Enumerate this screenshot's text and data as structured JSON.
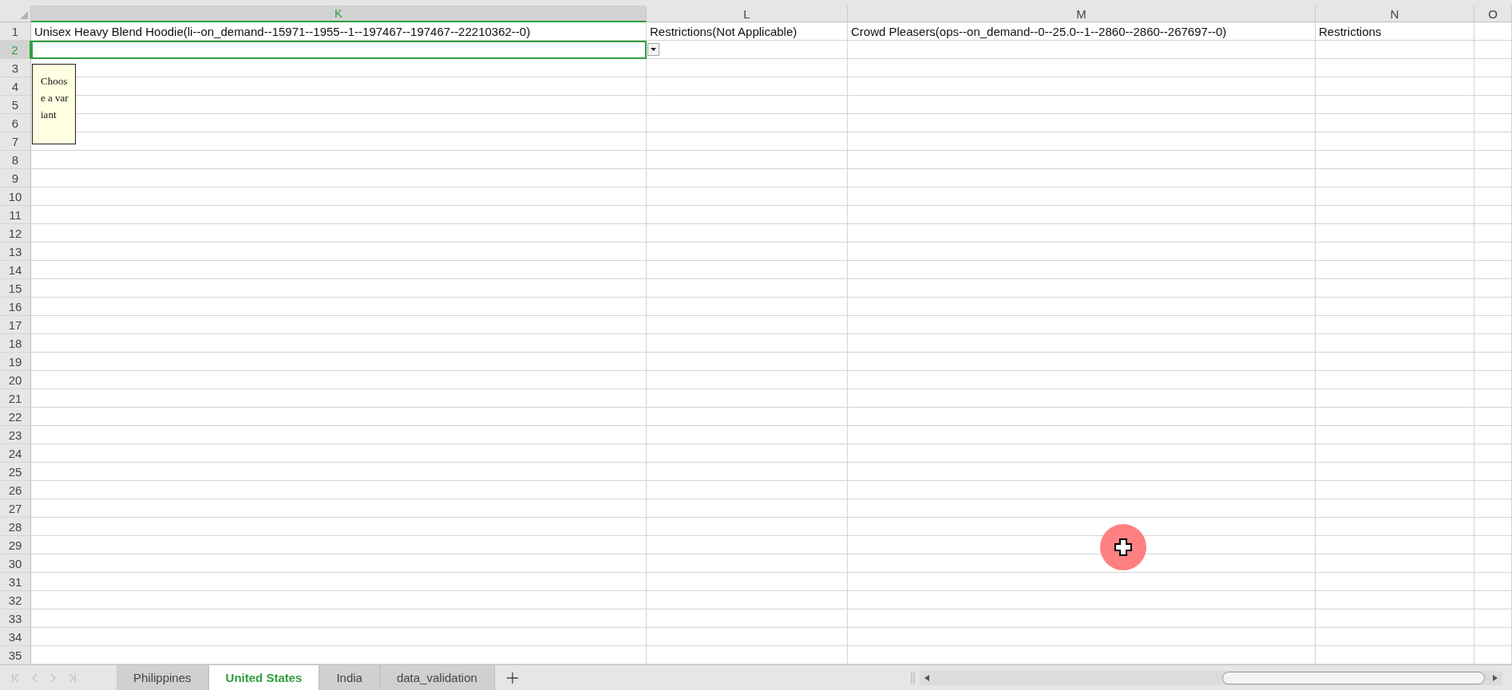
{
  "columns": [
    {
      "label": "K",
      "selected": true
    },
    {
      "label": "L",
      "selected": false
    },
    {
      "label": "M",
      "selected": false
    },
    {
      "label": "N",
      "selected": false
    },
    {
      "label": "O",
      "selected": false
    }
  ],
  "rows": [
    {
      "number": "1",
      "selected": false,
      "cells": [
        "Unisex Heavy Blend Hoodie(li--on_demand--15971--1955--1--197467--197467--22210362--0)",
        "Restrictions(Not Applicable)",
        "Crowd Pleasers(ops--on_demand--0--25.0--1--2860--2860--267697--0)",
        "Restrictions"
      ]
    },
    {
      "number": "2",
      "selected": true,
      "active": true,
      "dropdown": true
    },
    {
      "number": "3",
      "selected": false
    },
    {
      "number": "4",
      "selected": false
    },
    {
      "number": "5",
      "selected": false
    },
    {
      "number": "6",
      "selected": false
    },
    {
      "number": "7",
      "selected": false
    },
    {
      "number": "8",
      "selected": false
    },
    {
      "number": "9",
      "selected": false
    },
    {
      "number": "10",
      "selected": false
    },
    {
      "number": "11",
      "selected": false
    },
    {
      "number": "12",
      "selected": false
    },
    {
      "number": "13",
      "selected": false
    },
    {
      "number": "14",
      "selected": false
    },
    {
      "number": "15",
      "selected": false
    },
    {
      "number": "16",
      "selected": false
    },
    {
      "number": "17",
      "selected": false
    },
    {
      "number": "18",
      "selected": false
    },
    {
      "number": "19",
      "selected": false
    },
    {
      "number": "20",
      "selected": false
    },
    {
      "number": "21",
      "selected": false
    },
    {
      "number": "22",
      "selected": false
    },
    {
      "number": "23",
      "selected": false
    },
    {
      "number": "24",
      "selected": false
    },
    {
      "number": "25",
      "selected": false
    },
    {
      "number": "26",
      "selected": false
    },
    {
      "number": "27",
      "selected": false
    },
    {
      "number": "28",
      "selected": false
    },
    {
      "number": "29",
      "selected": false
    },
    {
      "number": "30",
      "selected": false
    },
    {
      "number": "31",
      "selected": false
    },
    {
      "number": "32",
      "selected": false
    },
    {
      "number": "33",
      "selected": false
    },
    {
      "number": "34",
      "selected": false
    },
    {
      "number": "35",
      "selected": false
    }
  ],
  "input_message": "Choose a variant",
  "sheet_tabs": [
    {
      "label": "Philippines",
      "selected": false
    },
    {
      "label": "United States",
      "selected": true
    },
    {
      "label": "India",
      "selected": false
    },
    {
      "label": "data_validation",
      "selected": false
    }
  ]
}
